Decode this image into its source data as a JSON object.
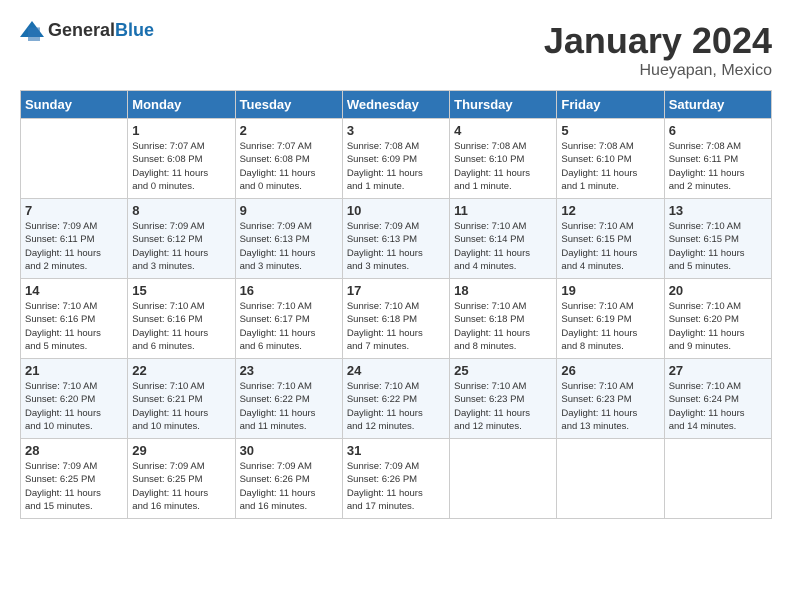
{
  "header": {
    "logo_general": "General",
    "logo_blue": "Blue",
    "month_title": "January 2024",
    "location": "Hueyapan, Mexico"
  },
  "days_of_week": [
    "Sunday",
    "Monday",
    "Tuesday",
    "Wednesday",
    "Thursday",
    "Friday",
    "Saturday"
  ],
  "weeks": [
    [
      {
        "day": "",
        "info": ""
      },
      {
        "day": "1",
        "info": "Sunrise: 7:07 AM\nSunset: 6:08 PM\nDaylight: 11 hours\nand 0 minutes."
      },
      {
        "day": "2",
        "info": "Sunrise: 7:07 AM\nSunset: 6:08 PM\nDaylight: 11 hours\nand 0 minutes."
      },
      {
        "day": "3",
        "info": "Sunrise: 7:08 AM\nSunset: 6:09 PM\nDaylight: 11 hours\nand 1 minute."
      },
      {
        "day": "4",
        "info": "Sunrise: 7:08 AM\nSunset: 6:10 PM\nDaylight: 11 hours\nand 1 minute."
      },
      {
        "day": "5",
        "info": "Sunrise: 7:08 AM\nSunset: 6:10 PM\nDaylight: 11 hours\nand 1 minute."
      },
      {
        "day": "6",
        "info": "Sunrise: 7:08 AM\nSunset: 6:11 PM\nDaylight: 11 hours\nand 2 minutes."
      }
    ],
    [
      {
        "day": "7",
        "info": "Sunrise: 7:09 AM\nSunset: 6:11 PM\nDaylight: 11 hours\nand 2 minutes."
      },
      {
        "day": "8",
        "info": "Sunrise: 7:09 AM\nSunset: 6:12 PM\nDaylight: 11 hours\nand 3 minutes."
      },
      {
        "day": "9",
        "info": "Sunrise: 7:09 AM\nSunset: 6:13 PM\nDaylight: 11 hours\nand 3 minutes."
      },
      {
        "day": "10",
        "info": "Sunrise: 7:09 AM\nSunset: 6:13 PM\nDaylight: 11 hours\nand 3 minutes."
      },
      {
        "day": "11",
        "info": "Sunrise: 7:10 AM\nSunset: 6:14 PM\nDaylight: 11 hours\nand 4 minutes."
      },
      {
        "day": "12",
        "info": "Sunrise: 7:10 AM\nSunset: 6:15 PM\nDaylight: 11 hours\nand 4 minutes."
      },
      {
        "day": "13",
        "info": "Sunrise: 7:10 AM\nSunset: 6:15 PM\nDaylight: 11 hours\nand 5 minutes."
      }
    ],
    [
      {
        "day": "14",
        "info": "Sunrise: 7:10 AM\nSunset: 6:16 PM\nDaylight: 11 hours\nand 5 minutes."
      },
      {
        "day": "15",
        "info": "Sunrise: 7:10 AM\nSunset: 6:16 PM\nDaylight: 11 hours\nand 6 minutes."
      },
      {
        "day": "16",
        "info": "Sunrise: 7:10 AM\nSunset: 6:17 PM\nDaylight: 11 hours\nand 6 minutes."
      },
      {
        "day": "17",
        "info": "Sunrise: 7:10 AM\nSunset: 6:18 PM\nDaylight: 11 hours\nand 7 minutes."
      },
      {
        "day": "18",
        "info": "Sunrise: 7:10 AM\nSunset: 6:18 PM\nDaylight: 11 hours\nand 8 minutes."
      },
      {
        "day": "19",
        "info": "Sunrise: 7:10 AM\nSunset: 6:19 PM\nDaylight: 11 hours\nand 8 minutes."
      },
      {
        "day": "20",
        "info": "Sunrise: 7:10 AM\nSunset: 6:20 PM\nDaylight: 11 hours\nand 9 minutes."
      }
    ],
    [
      {
        "day": "21",
        "info": "Sunrise: 7:10 AM\nSunset: 6:20 PM\nDaylight: 11 hours\nand 10 minutes."
      },
      {
        "day": "22",
        "info": "Sunrise: 7:10 AM\nSunset: 6:21 PM\nDaylight: 11 hours\nand 10 minutes."
      },
      {
        "day": "23",
        "info": "Sunrise: 7:10 AM\nSunset: 6:22 PM\nDaylight: 11 hours\nand 11 minutes."
      },
      {
        "day": "24",
        "info": "Sunrise: 7:10 AM\nSunset: 6:22 PM\nDaylight: 11 hours\nand 12 minutes."
      },
      {
        "day": "25",
        "info": "Sunrise: 7:10 AM\nSunset: 6:23 PM\nDaylight: 11 hours\nand 12 minutes."
      },
      {
        "day": "26",
        "info": "Sunrise: 7:10 AM\nSunset: 6:23 PM\nDaylight: 11 hours\nand 13 minutes."
      },
      {
        "day": "27",
        "info": "Sunrise: 7:10 AM\nSunset: 6:24 PM\nDaylight: 11 hours\nand 14 minutes."
      }
    ],
    [
      {
        "day": "28",
        "info": "Sunrise: 7:09 AM\nSunset: 6:25 PM\nDaylight: 11 hours\nand 15 minutes."
      },
      {
        "day": "29",
        "info": "Sunrise: 7:09 AM\nSunset: 6:25 PM\nDaylight: 11 hours\nand 16 minutes."
      },
      {
        "day": "30",
        "info": "Sunrise: 7:09 AM\nSunset: 6:26 PM\nDaylight: 11 hours\nand 16 minutes."
      },
      {
        "day": "31",
        "info": "Sunrise: 7:09 AM\nSunset: 6:26 PM\nDaylight: 11 hours\nand 17 minutes."
      },
      {
        "day": "",
        "info": ""
      },
      {
        "day": "",
        "info": ""
      },
      {
        "day": "",
        "info": ""
      }
    ]
  ]
}
